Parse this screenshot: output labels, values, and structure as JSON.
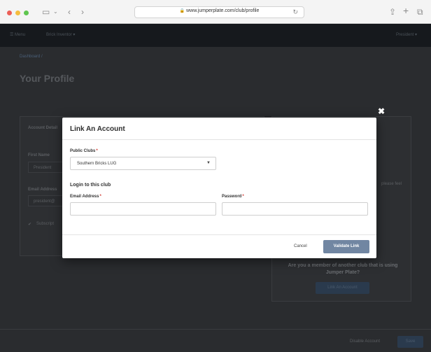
{
  "browser": {
    "url": "www.jumperplate.com/club/profile",
    "lock_glyph": "🔒",
    "reload_glyph": "↻"
  },
  "nav": {
    "menu_label": "☰ Menu",
    "brick_label": "Brick Inventor ▾",
    "user_label": "President ▾"
  },
  "background": {
    "breadcrumb": "Dashboard /",
    "page_title": "Your Profile",
    "account_details_tab": "Account Detail",
    "first_name_label": "First Name",
    "first_name_value": "President",
    "email_label": "Email Address",
    "email_value": "president@",
    "subscribe_label": "Subscript",
    "side_note": "please feel",
    "question": "Are you a member of another club that is using Jumper Plate?",
    "link_account_button": "Link An Account",
    "disable_account": "Disable Account",
    "save": "Save"
  },
  "modal": {
    "title": "Link An Account",
    "close_glyph": "✖",
    "public_clubs_label": "Public Clubs",
    "required_mark": "*",
    "selected_club": "Southern Bricks LUG",
    "login_heading": "Login to this club",
    "email_label": "Email Address",
    "password_label": "Password",
    "email_value": "",
    "password_value": "",
    "cancel_label": "Cancel",
    "validate_label": "Validate Link"
  }
}
